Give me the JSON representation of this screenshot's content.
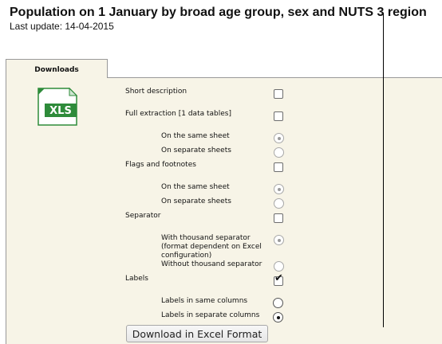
{
  "page": {
    "title": "Population on 1 January by broad age group, sex and NUTS 3 region",
    "last_update": "Last update: 14-04-2015"
  },
  "tabs": [
    {
      "label": "Downloads",
      "active": true
    }
  ],
  "file_icon": {
    "name": "xls-file-icon",
    "text": "XLS",
    "color": "#2e8b3a"
  },
  "options": {
    "short_description": {
      "label": "Short description",
      "checked": false
    },
    "full_extraction": {
      "label": "Full extraction [1 data tables]",
      "checked": false
    },
    "same_sheet": {
      "label": "On the same sheet",
      "selected": true,
      "enabled": false
    },
    "separate_sheets": {
      "label": "On separate sheets",
      "selected": false,
      "enabled": false
    },
    "flags": {
      "label": "Flags and footnotes",
      "checked": false
    },
    "flags_same_sheet": {
      "label": "On the same sheet",
      "selected": true,
      "enabled": false
    },
    "flags_separate_sheets": {
      "label": "On separate sheets",
      "selected": false,
      "enabled": false
    },
    "separator": {
      "label": "Separator",
      "checked": false
    },
    "with_thousand": {
      "label": "With thousand separator (format dependent on Excel configuration)",
      "selected": true,
      "enabled": false
    },
    "without_thousand": {
      "label": "Without thousand separator",
      "selected": false,
      "enabled": false
    },
    "labels": {
      "label": "Labels",
      "checked": true
    },
    "labels_same_columns": {
      "label": "Labels in same columns",
      "selected": false,
      "enabled": true
    },
    "labels_separate_columns": {
      "label": "Labels in separate columns",
      "selected": true,
      "enabled": true
    }
  },
  "download_button": {
    "label": "Download in Excel Format"
  },
  "colors": {
    "panel_background": "#f7f4e7",
    "xls_green": "#2e8b3a"
  }
}
